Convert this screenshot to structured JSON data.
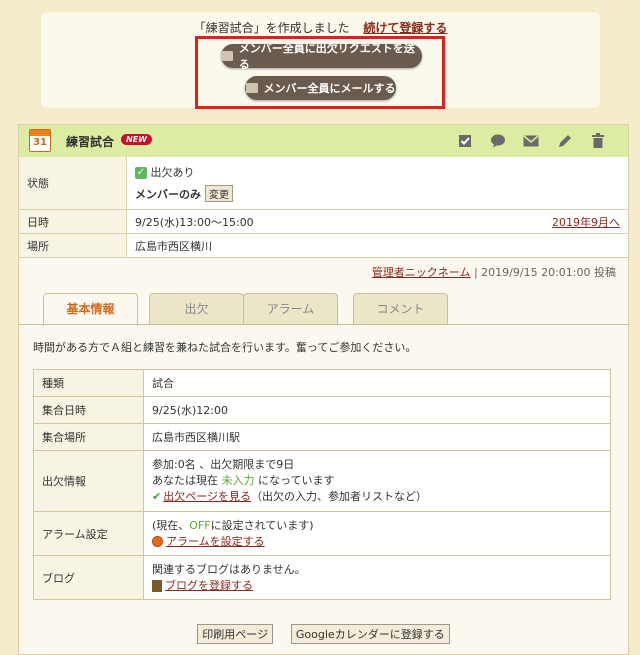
{
  "notice": {
    "message": "「練習試合」を作成しました",
    "continue_link": "続けて登録する",
    "request_button": "メンバー全員に出欠リクエストを送る",
    "mail_button": "メンバー全員にメールする"
  },
  "event": {
    "calendar_day": "31",
    "title": "練習試合",
    "badge": "NEW",
    "tools": [
      "checkbox-icon",
      "comment-icon",
      "mail-icon",
      "edit-icon",
      "trash-icon"
    ],
    "status_label": "状態",
    "attendance": "出欠あり",
    "visibility": "メンバーのみ",
    "change_button": "変更",
    "date_label": "日時",
    "date_value": "9/25(水)13:00〜15:00",
    "month_link": "2019年9月へ",
    "place_label": "場所",
    "place_value": "広島市西区横川"
  },
  "posted": {
    "author": "管理者ニックネーム",
    "info": "| 2019/9/15 20:01:00 投稿"
  },
  "tabs": [
    "基本情報",
    "出欠",
    "アラーム",
    "コメント"
  ],
  "description": "時間がある方でＡ組と練習を兼ねた試合を行います。奮ってご参加ください。",
  "details": {
    "type_label": "種類",
    "type_value": "試合",
    "meet_time_label": "集合日時",
    "meet_time_value": "9/25(水)12:00",
    "meet_place_label": "集合場所",
    "meet_place_value": "広島市西区横川駅",
    "att_label": "出欠情報",
    "att_line1": "参加:0名 、出欠期限まで9日",
    "att_line2_pre": "あなたは現在",
    "att_line2_status": "未入力",
    "att_line2_post": "になっています",
    "att_link": "出欠ページを見る",
    "att_link_note": "（出欠の入力、参加者リストなど）",
    "alarm_label": "アラーム設定",
    "alarm_pre": "(現在、",
    "alarm_off": "OFF",
    "alarm_post": "に設定されています)",
    "alarm_link": "アラームを設定する",
    "blog_label": "ブログ",
    "blog_line": "関連するブログはありません。",
    "blog_link": "ブログを登録する"
  },
  "buttons": {
    "print": "印刷用ページ",
    "google": "Googleカレンダーに登録する"
  },
  "colors": {
    "header_bg": "#dceda3",
    "accent_tab": "#d26a1a",
    "highlight_border": "#e02020",
    "link": "#8a2a1a"
  }
}
